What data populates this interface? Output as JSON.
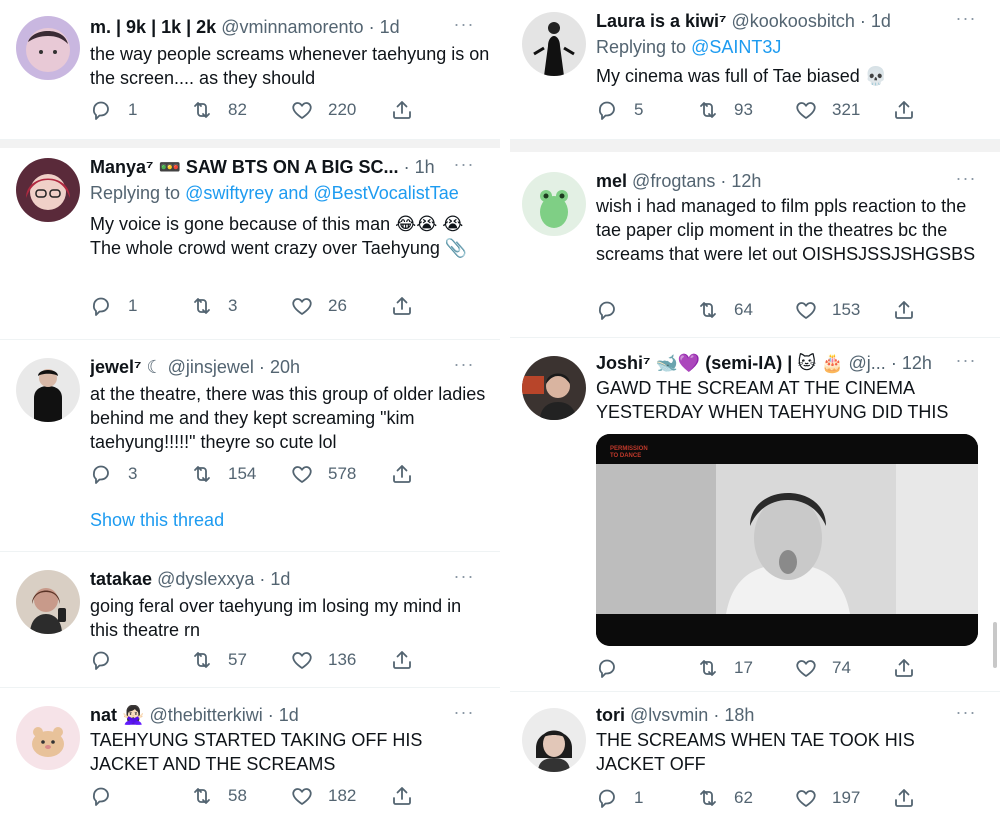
{
  "left": [
    {
      "name": "m. | 9k | 1k | 2k",
      "handle": "@vminnamorento",
      "time": "1d",
      "text": "the way people screams whenever taehyung is on the screen.... as they should",
      "replies": "1",
      "retweets": "82",
      "likes": "220"
    },
    {
      "name": "Manya⁷ 🚥 SAW BTS ON A BIG SC...",
      "time": "1h",
      "replying_label": "Replying to",
      "replying_to": "@swiftyrey and @BestVocalistTae",
      "text": "My voice is gone because of this man 😂😭 😭 The whole crowd went crazy over Taehyung 📎",
      "replies": "1",
      "retweets": "3",
      "likes": "26"
    },
    {
      "name": "jewel⁷",
      "handle": "☾ @jinsjewel",
      "time": "20h",
      "text": "at the theatre, there was this group of older ladies behind me and they kept screaming \"kim taehyung!!!!!\" theyre so cute lol",
      "replies": "3",
      "retweets": "154",
      "likes": "578",
      "thread_link": "Show this thread"
    },
    {
      "name": "tatakae",
      "handle": "@dyslexxya",
      "time": "1d",
      "text": "going feral over taehyung im losing my mind in this theatre rn",
      "replies": "",
      "retweets": "57",
      "likes": "136"
    },
    {
      "name": "nat 🙅🏻‍♀️",
      "handle": "@thebitterkiwi",
      "time": "1d",
      "text": "TAEHYUNG STARTED TAKING OFF HIS JACKET AND THE SCREAMS",
      "replies": "",
      "retweets": "58",
      "likes": "182"
    }
  ],
  "right": [
    {
      "name": "Laura is a kiwi⁷",
      "handle": "@kookoosbitch",
      "time": "1d",
      "replying_label": "Replying to",
      "replying_to": "@SAINT3J",
      "text": "My cinema was full of Tae biased 💀",
      "replies": "5",
      "retweets": "93",
      "likes": "321"
    },
    {
      "name": "mel",
      "handle": "@frogtans",
      "time": "12h",
      "text": "wish i had managed to film ppls reaction to the tae paper clip moment in the theatres bc the screams that were let out OISHSJSSJSHGSBS",
      "replies": "",
      "retweets": "64",
      "likes": "153"
    },
    {
      "name": "Joshi⁷ 🐋💜 (semi-IA) | 🐱 🎂",
      "handle": "@j...",
      "time": "12h",
      "text": "GAWD THE SCREAM AT THE CINEMA YESTERDAY WHEN TAEHYUNG DID THIS",
      "media_caption": "PERMISSION TO DANCE",
      "replies": "",
      "retweets": "17",
      "likes": "74"
    },
    {
      "name": "tori",
      "handle": "@lvsvmin",
      "time": "18h",
      "text": "THE SCREAMS WHEN TAE TOOK HIS JACKET OFF",
      "replies": "1",
      "retweets": "62",
      "likes": "197"
    }
  ],
  "colors": {
    "link": "#1d9bf0",
    "muted": "#536471",
    "text": "#0f1419",
    "separator": "#f2f2f2"
  },
  "icons": [
    "reply-icon",
    "retweet-icon",
    "like-icon",
    "share-icon",
    "more-icon"
  ]
}
